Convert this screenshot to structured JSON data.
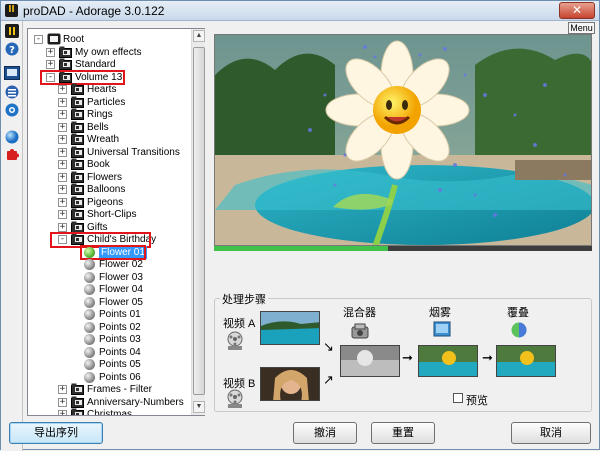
{
  "window": {
    "title": "proDAD - Adorage 3.0.122",
    "close_glyph": "✕",
    "menu_label": "Menu"
  },
  "left_toolbar": {
    "icons": [
      "app-logo-icon",
      "help-icon",
      "preview-window-icon",
      "effect-list-icon",
      "settings-icon",
      "globe-icon",
      "puzzle-icon"
    ]
  },
  "tree": {
    "items": [
      {
        "label": "Root"
      },
      {
        "label": "My own effects"
      },
      {
        "label": "Standard"
      },
      {
        "label": "Volume 13"
      },
      {
        "label": "Hearts"
      },
      {
        "label": "Particles"
      },
      {
        "label": "Rings"
      },
      {
        "label": "Bells"
      },
      {
        "label": "Wreath"
      },
      {
        "label": "Universal Transitions"
      },
      {
        "label": "Book"
      },
      {
        "label": "Flowers"
      },
      {
        "label": "Balloons"
      },
      {
        "label": "Pigeons"
      },
      {
        "label": "Short-Clips"
      },
      {
        "label": "Gifts"
      },
      {
        "label": "Child's Birthday"
      },
      {
        "label": "Flower 01"
      },
      {
        "label": "Flower 02"
      },
      {
        "label": "Flower 03"
      },
      {
        "label": "Flower 04"
      },
      {
        "label": "Flower 05"
      },
      {
        "label": "Points 01"
      },
      {
        "label": "Points 02"
      },
      {
        "label": "Points 03"
      },
      {
        "label": "Points 04"
      },
      {
        "label": "Points 05"
      },
      {
        "label": "Points 06"
      },
      {
        "label": "Frames - Filter"
      },
      {
        "label": "Anniversary-Numbers"
      },
      {
        "label": "Christmas"
      }
    ]
  },
  "preview": {
    "progress": 0.46,
    "accent_color": "#3fc14a"
  },
  "steps": {
    "title": "处理步骤",
    "video_a": "视频 A",
    "video_b": "视频 B",
    "mixer": "混合器",
    "smoke": "烟雾",
    "overlay": "覆叠",
    "preview_checkbox": "预览",
    "preview_checked": false
  },
  "buttons": {
    "export": "导出序列",
    "cancel_mid": "撤消",
    "reset": "重置",
    "cancel": "取消"
  }
}
